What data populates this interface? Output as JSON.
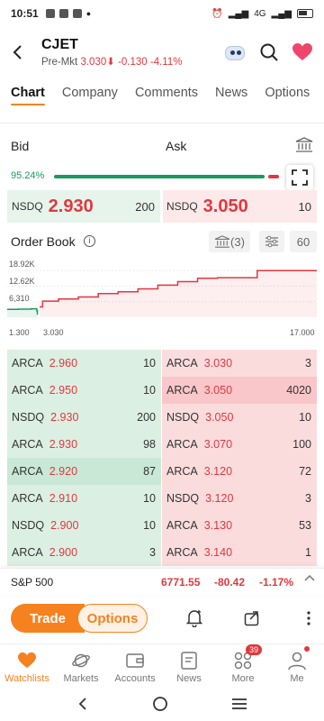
{
  "status_bar": {
    "time": "10:51",
    "network": "4G"
  },
  "header": {
    "ticker": "CJET",
    "session_label": "Pre-Mkt",
    "price": "3.030",
    "change": "-0.130",
    "change_pct": "-4.11%"
  },
  "tabs": [
    {
      "label": "Chart",
      "active": true
    },
    {
      "label": "Company"
    },
    {
      "label": "Comments"
    },
    {
      "label": "News"
    },
    {
      "label": "Options"
    }
  ],
  "bid_ask": {
    "bid_label": "Bid",
    "ask_label": "Ask",
    "bid_ratio_pct": "95.24%",
    "bid_ratio": 0.9524,
    "bid": {
      "exchange": "NSDQ",
      "price": "2.930",
      "size": "200"
    },
    "ask": {
      "exchange": "NSDQ",
      "price": "3.050",
      "size": "10"
    }
  },
  "order_book": {
    "title": "Order Book",
    "exchanges_chip": "(3)",
    "depth_chip": "60",
    "chart_data": {
      "type": "area",
      "y_ticks": [
        "18.92K",
        "12.62K",
        "6,310"
      ],
      "x_ticks": [
        "1.300",
        "3.030",
        "17.000"
      ],
      "bid_series": {
        "x": [
          1.3,
          1.9,
          2.6,
          2.9,
          2.93
        ],
        "y": [
          3200,
          3300,
          3400,
          2600,
          1000
        ]
      },
      "ask_series": {
        "x": [
          3.05,
          3.2,
          4.0,
          5.0,
          6.0,
          7.0,
          8.0,
          9.0,
          10.0,
          11.0,
          12.0,
          14.0,
          17.0
        ],
        "y": [
          4200,
          6500,
          7400,
          8200,
          9600,
          10300,
          11500,
          13000,
          14400,
          15800,
          16000,
          18900,
          18920
        ]
      }
    },
    "rows": [
      {
        "bid": {
          "exchange": "ARCA",
          "price": "2.960",
          "size": "10"
        },
        "ask": {
          "exchange": "ARCA",
          "price": "3.030",
          "size": "3"
        }
      },
      {
        "bid": {
          "exchange": "ARCA",
          "price": "2.950",
          "size": "10"
        },
        "ask": {
          "exchange": "ARCA",
          "price": "3.050",
          "size": "4020"
        }
      },
      {
        "bid": {
          "exchange": "NSDQ",
          "price": "2.930",
          "size": "200"
        },
        "ask": {
          "exchange": "NSDQ",
          "price": "3.050",
          "size": "10"
        }
      },
      {
        "bid": {
          "exchange": "ARCA",
          "price": "2.930",
          "size": "98"
        },
        "ask": {
          "exchange": "ARCA",
          "price": "3.070",
          "size": "100"
        }
      },
      {
        "bid": {
          "exchange": "ARCA",
          "price": "2.920",
          "size": "87"
        },
        "ask": {
          "exchange": "ARCA",
          "price": "3.120",
          "size": "72"
        }
      },
      {
        "bid": {
          "exchange": "ARCA",
          "price": "2.910",
          "size": "10"
        },
        "ask": {
          "exchange": "NSDQ",
          "price": "3.120",
          "size": "3"
        }
      },
      {
        "bid": {
          "exchange": "NSDQ",
          "price": "2.900",
          "size": "10"
        },
        "ask": {
          "exchange": "ARCA",
          "price": "3.130",
          "size": "53"
        }
      },
      {
        "bid": {
          "exchange": "ARCA",
          "price": "2.900",
          "size": "3"
        },
        "ask": {
          "exchange": "ARCA",
          "price": "3.140",
          "size": "1"
        }
      }
    ]
  },
  "index_bar": {
    "name": "S&P 500",
    "value": "6771.55",
    "change": "-80.42",
    "change_pct": "-1.17%"
  },
  "actions": {
    "trade_label": "Trade",
    "options_label": "Options"
  },
  "bottom_nav": [
    {
      "label": "Watchlists",
      "icon": "heart-icon",
      "active": true
    },
    {
      "label": "Markets",
      "icon": "planet-icon"
    },
    {
      "label": "Accounts",
      "icon": "wallet-icon"
    },
    {
      "label": "News",
      "icon": "document-icon"
    },
    {
      "label": "More",
      "icon": "grid-icon",
      "badge": "39"
    },
    {
      "label": "Me",
      "icon": "person-icon"
    }
  ],
  "colors": {
    "accent": "#f5821f",
    "up_green": "#1a9a5e",
    "down_red": "#e0383e"
  }
}
